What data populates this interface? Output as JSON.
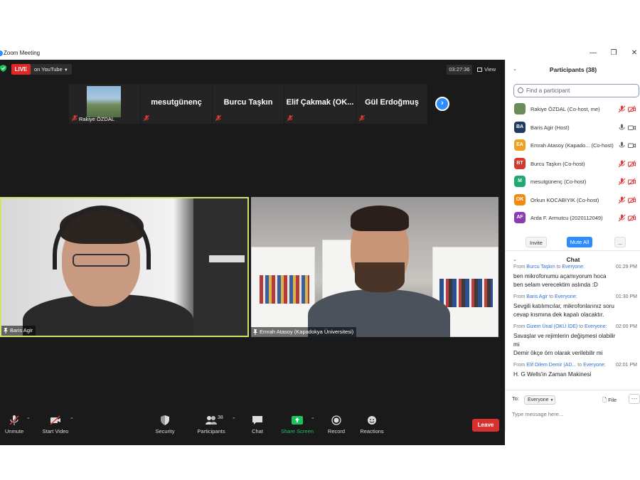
{
  "window": {
    "title": "Zoom Meeting"
  },
  "stream": {
    "live_label": "LIVE",
    "live_target": "on YouTube",
    "timer": "03:27:36",
    "view_label": "View"
  },
  "thumbnails": [
    {
      "name": "Rakiye ÖZDAL",
      "has_video": true
    },
    {
      "name": "mesutgünenç",
      "has_video": false
    },
    {
      "name": "Burcu Taşkın",
      "has_video": false
    },
    {
      "name": "Elif  Çakmak  (OK...",
      "has_video": false
    },
    {
      "name": "Gül Erdoğmuş",
      "has_video": false
    }
  ],
  "tiles": [
    {
      "name": "Baris Agir",
      "active_speaker": true
    },
    {
      "name": "Emrah Atasoy (Kapadokya Üniversitesi)",
      "active_speaker": false
    }
  ],
  "toolbar": {
    "unmute": "Unmute",
    "start_video": "Start Video",
    "security": "Security",
    "participants": "Participants",
    "participants_count": "38",
    "chat": "Chat",
    "share_screen": "Share Screen",
    "record": "Record",
    "reactions": "Reactions",
    "leave": "Leave"
  },
  "participants_panel": {
    "title": "Participants (38)",
    "search_placeholder": "Find a participant",
    "invite": "Invite",
    "mute_all": "Mute All",
    "more": "...",
    "items": [
      {
        "initials": "",
        "color": "#6b8c5a",
        "name": "Rakiye ÖZDAL (Co-host, me)",
        "audio": "muted",
        "video": "off"
      },
      {
        "initials": "BA",
        "color": "#1f3a5f",
        "name": "Baris Agir (Host)",
        "audio": "on",
        "video": "on"
      },
      {
        "initials": "EA",
        "color": "#f0a020",
        "name": "Emrah Atasoy (Kapado... (Co-host)",
        "audio": "on",
        "video": "on"
      },
      {
        "initials": "BT",
        "color": "#d23a2e",
        "name": "Burcu Taşkın (Co-host)",
        "audio": "muted",
        "video": "off"
      },
      {
        "initials": "M",
        "color": "#1faa70",
        "name": "mesutgünenç (Co-host)",
        "audio": "muted",
        "video": "off"
      },
      {
        "initials": "OK",
        "color": "#f08a10",
        "name": "Orkun KOCABIYIK (Co-host)",
        "audio": "muted",
        "video": "off"
      },
      {
        "initials": "AF",
        "color": "#8a3cb0",
        "name": "Arda F. Armutcu (2020112049)",
        "audio": "muted",
        "video": "off"
      }
    ]
  },
  "chat_panel": {
    "title": "Chat",
    "messages": [
      {
        "from_label": "From",
        "from": "Burcu Taşkın",
        "to_label": "to",
        "to": "Everyone:",
        "time": "01:29 PM",
        "lines": [
          "ben mikrofonumu açamıyorum hoca",
          "ben selam verecektim aslında :D"
        ]
      },
      {
        "from_label": "From",
        "from": "Baris Agir",
        "to_label": "to",
        "to": "Everyone:",
        "time": "01:30 PM",
        "lines": [
          "Sevgili katılımcılar, mikrofonlarınız soru",
          "cevap kısmına dek kapalı olacaktır."
        ]
      },
      {
        "from_label": "From",
        "from": "Gizem Ünal (OKÜ İDE)",
        "to_label": "to",
        "to": "Everyone:",
        "time": "02:00 PM",
        "lines": [
          "Savaşlar ve rejimlerin değişmesi olabilir",
          "mi",
          "Demir ökçe örn olarak verilebilir mi"
        ]
      },
      {
        "from_label": "From",
        "from": "Elif Dilem Demir (AD...",
        "to_label": "to",
        "to": "Everyone:",
        "time": "02:01 PM",
        "lines": [
          "H. G Wells'in Zaman Makinesi"
        ]
      }
    ],
    "to_label": "To:",
    "to_value": "Everyone",
    "file_label": "File",
    "more_label": "···",
    "input_placeholder": "Type message here..."
  },
  "colors": {
    "accent": "#2d8cff",
    "live": "#e02828",
    "leave": "#d8302f",
    "share": "#1bc45a",
    "speaker_border": "#cfe36a"
  },
  "icons": [
    "shield-check-icon",
    "grid-view-icon",
    "mic-muted-icon",
    "video-off-icon",
    "security-shield-icon",
    "participants-icon",
    "chat-bubble-icon",
    "share-screen-icon",
    "record-icon",
    "reactions-icon",
    "chevron-right-icon",
    "search-icon",
    "file-icon"
  ]
}
